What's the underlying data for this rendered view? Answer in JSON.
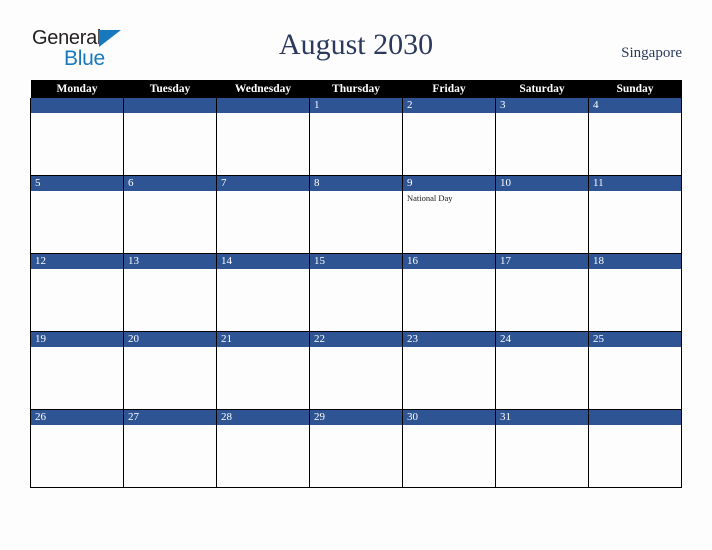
{
  "brand": {
    "name_part1": "General",
    "name_part2": "Blue",
    "triangle_icon": "triangle-icon",
    "color_dark": "#231f20",
    "color_blue": "#1878be"
  },
  "header": {
    "title": "August 2030",
    "location": "Singapore",
    "title_color": "#2b3a5c"
  },
  "calendar": {
    "month": "August",
    "year": "2030",
    "accent_color": "#2e5493",
    "header_bg": "#000000",
    "weekdays": [
      "Monday",
      "Tuesday",
      "Wednesday",
      "Thursday",
      "Friday",
      "Saturday",
      "Sunday"
    ],
    "weeks": [
      [
        {
          "day": "",
          "events": []
        },
        {
          "day": "",
          "events": []
        },
        {
          "day": "",
          "events": []
        },
        {
          "day": "1",
          "events": []
        },
        {
          "day": "2",
          "events": []
        },
        {
          "day": "3",
          "events": []
        },
        {
          "day": "4",
          "events": []
        }
      ],
      [
        {
          "day": "5",
          "events": []
        },
        {
          "day": "6",
          "events": []
        },
        {
          "day": "7",
          "events": []
        },
        {
          "day": "8",
          "events": []
        },
        {
          "day": "9",
          "events": [
            "National Day"
          ]
        },
        {
          "day": "10",
          "events": []
        },
        {
          "day": "11",
          "events": []
        }
      ],
      [
        {
          "day": "12",
          "events": []
        },
        {
          "day": "13",
          "events": []
        },
        {
          "day": "14",
          "events": []
        },
        {
          "day": "15",
          "events": []
        },
        {
          "day": "16",
          "events": []
        },
        {
          "day": "17",
          "events": []
        },
        {
          "day": "18",
          "events": []
        }
      ],
      [
        {
          "day": "19",
          "events": []
        },
        {
          "day": "20",
          "events": []
        },
        {
          "day": "21",
          "events": []
        },
        {
          "day": "22",
          "events": []
        },
        {
          "day": "23",
          "events": []
        },
        {
          "day": "24",
          "events": []
        },
        {
          "day": "25",
          "events": []
        }
      ],
      [
        {
          "day": "26",
          "events": []
        },
        {
          "day": "27",
          "events": []
        },
        {
          "day": "28",
          "events": []
        },
        {
          "day": "29",
          "events": []
        },
        {
          "day": "30",
          "events": []
        },
        {
          "day": "31",
          "events": []
        },
        {
          "day": "",
          "events": []
        }
      ]
    ]
  }
}
